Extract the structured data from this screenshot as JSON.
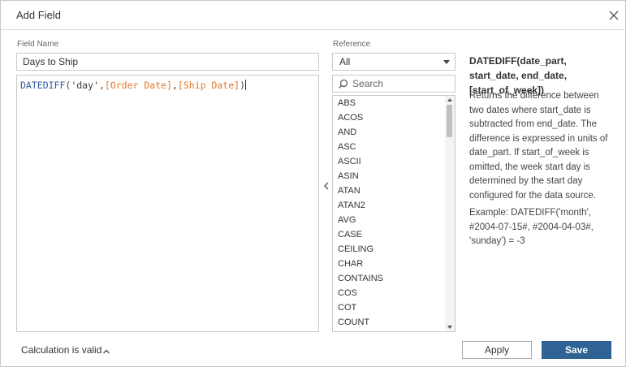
{
  "dialog": {
    "title": "Add Field",
    "close_icon": "close-icon"
  },
  "field_name": {
    "label": "Field Name",
    "value": "Days to Ship"
  },
  "calculation": {
    "tokens": [
      {
        "type": "func",
        "text": "DATEDIFF"
      },
      {
        "type": "punc",
        "text": "("
      },
      {
        "type": "str",
        "text": "'day'"
      },
      {
        "type": "punc",
        "text": ","
      },
      {
        "type": "field",
        "text": "[Order Date]"
      },
      {
        "type": "punc",
        "text": ","
      },
      {
        "type": "field",
        "text": "[Ship Date]"
      },
      {
        "type": "punc",
        "text": ")"
      }
    ]
  },
  "reference": {
    "label": "Reference",
    "selected": "All",
    "search_placeholder": "Search",
    "functions": [
      "ABS",
      "ACOS",
      "AND",
      "ASC",
      "ASCII",
      "ASIN",
      "ATAN",
      "ATAN2",
      "AVG",
      "CASE",
      "CEILING",
      "CHAR",
      "CONTAINS",
      "COS",
      "COT",
      "COUNT"
    ]
  },
  "help": {
    "signature": "DATEDIFF(date_part, start_date, end_date, [start_of_week])",
    "description": "Returns the difference between two dates where start_date is subtracted from end_date. The difference is expressed in units of date_part. If start_of_week is omitted, the week start day is determined by the start day configured for the data source.",
    "example": "Example: DATEDIFF('month', #2004-07-15#, #2004-04-03#, 'sunday') = -3"
  },
  "footer": {
    "status": "Calculation is valid",
    "apply_label": "Apply",
    "save_label": "Save"
  },
  "colors": {
    "save_button": "#2f6396",
    "field_token": "#e0782a",
    "function_token": "#2f5f9a"
  }
}
